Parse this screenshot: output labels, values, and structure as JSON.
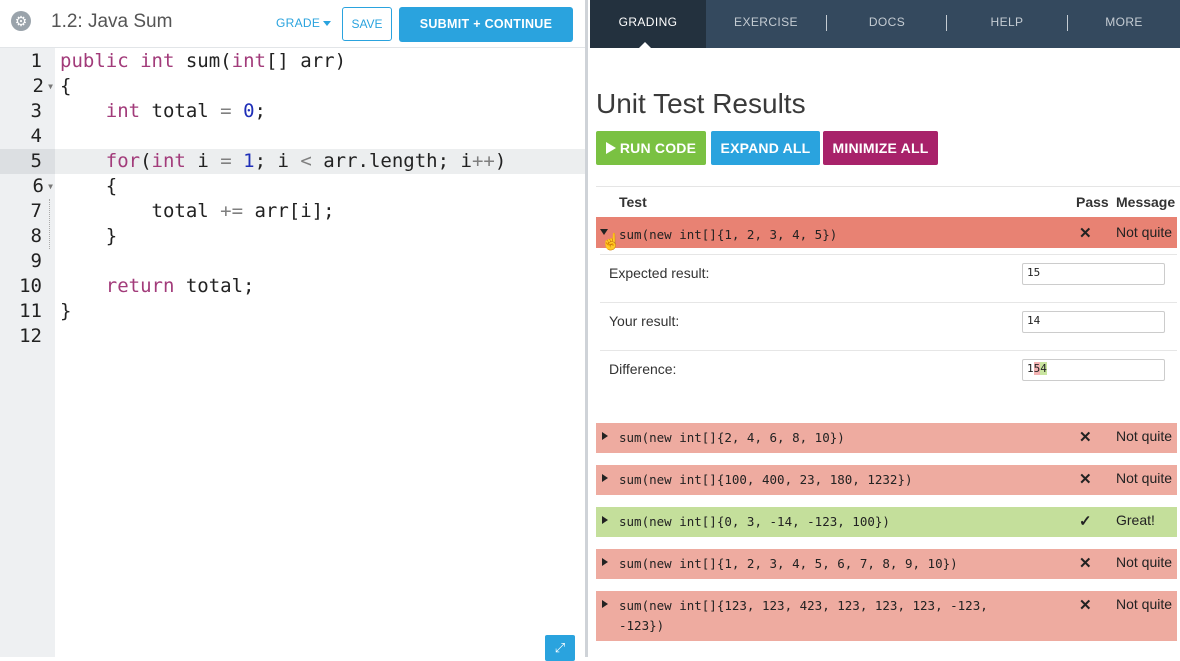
{
  "editor_header": {
    "title": "1.2: Java Sum",
    "grade_label": "GRADE",
    "save_label": "SAVE",
    "submit_label": "SUBMIT + CONTINUE"
  },
  "code": {
    "line_numbers": [
      "1",
      "2",
      "3",
      "4",
      "5",
      "6",
      "7",
      "8",
      "9",
      "10",
      "11",
      "12"
    ],
    "current_line": "5"
  },
  "tabs": [
    {
      "label": "GRADING"
    },
    {
      "label": "EXERCISE"
    },
    {
      "label": "DOCS"
    },
    {
      "label": "HELP"
    },
    {
      "label": "MORE"
    }
  ],
  "results": {
    "heading": "Unit Test Results",
    "run_label": "RUN CODE",
    "expand_label": "EXPAND ALL",
    "minimize_label": "MINIMIZE ALL",
    "col_test": "Test",
    "col_pass": "Pass",
    "col_message": "Message",
    "expanded": {
      "test": "sum(new int[]{1, 2, 3, 4, 5})",
      "mark": "✕",
      "message": "Not quite",
      "expected_label": "Expected result:",
      "expected_value": "15",
      "your_label": "Your result:",
      "your_value": "14",
      "diff_label": "Difference:",
      "diff_prefix": "1",
      "diff_removed": "5",
      "diff_added": "4"
    },
    "rows": [
      {
        "test": "sum(new int[]{2, 4, 6, 8, 10})",
        "mark": "✕",
        "message": "Not quite"
      },
      {
        "test": "sum(new int[]{100, 400, 23, 180, 1232})",
        "mark": "✕",
        "message": "Not quite"
      },
      {
        "test": "sum(new int[]{0, 3, -14, -123, 100})",
        "mark": "✓",
        "message": "Great!"
      },
      {
        "test": "sum(new int[]{1, 2, 3, 4, 5, 6, 7, 8, 9, 10})",
        "mark": "✕",
        "message": "Not quite"
      },
      {
        "test": "sum(new int[]{123, 123, 423, 123, 123, 123, -123, -123})",
        "mark": "✕",
        "message": "Not quite"
      }
    ]
  }
}
